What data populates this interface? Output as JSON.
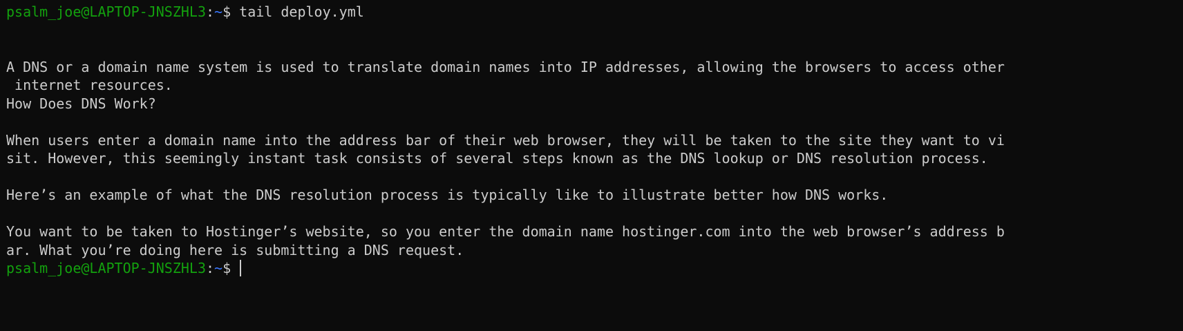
{
  "terminal": {
    "prompt": {
      "user_host": "psalm_joe@LAPTOP-JNSZHL3",
      "separator": ":",
      "path": "~",
      "symbol": "$"
    },
    "command": " tail deploy.yml",
    "output_lines": [
      "",
      "",
      "A DNS or a domain name system is used to translate domain names into IP addresses, allowing the browsers to access other",
      " internet resources.",
      "How Does DNS Work?",
      "",
      "When users enter a domain name into the address bar of their web browser, they will be taken to the site they want to vi",
      "sit. However, this seemingly instant task consists of several steps known as the DNS lookup or DNS resolution process.",
      "",
      "Here’s an example of what the DNS resolution process is typically like to illustrate better how DNS works.",
      "",
      "You want to be taken to Hostinger’s website, so you enter the domain name hostinger.com into the web browser’s address b",
      "ar. What you’re doing here is submitting a DNS request."
    ],
    "colors": {
      "background": "#0c0c0c",
      "text": "#cccccc",
      "user_host": "#13a10e",
      "path": "#3b78ff"
    }
  }
}
